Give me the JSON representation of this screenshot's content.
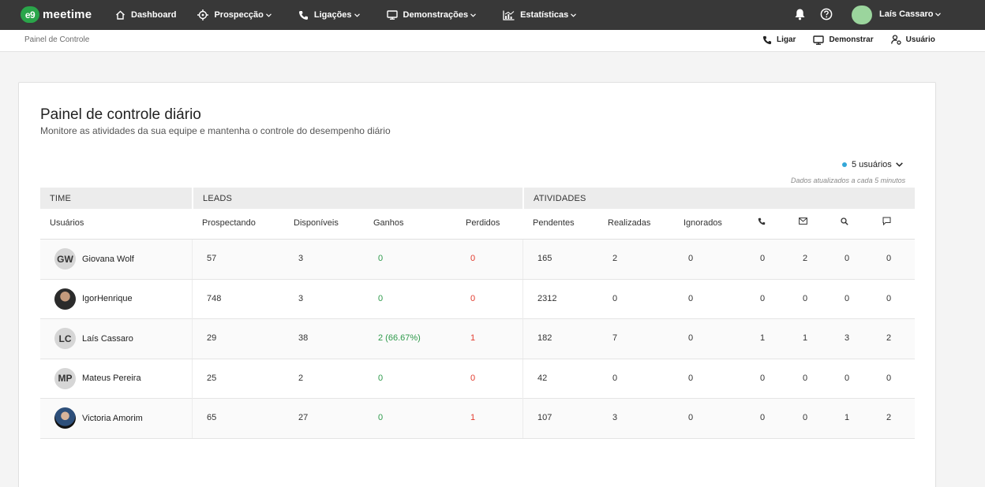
{
  "nav": {
    "logo_mark": "e9",
    "logo_text": "meetime",
    "items": [
      {
        "label": "Dashboard",
        "icon": "home-icon",
        "dropdown": false
      },
      {
        "label": "Prospecção",
        "icon": "target-icon",
        "dropdown": true
      },
      {
        "label": "Ligações",
        "icon": "phone-icon",
        "dropdown": true
      },
      {
        "label": "Demonstrações",
        "icon": "monitor-icon",
        "dropdown": true
      },
      {
        "label": "Estatísticas",
        "icon": "chart-icon",
        "dropdown": true
      }
    ],
    "user_name": "Laís Cassaro"
  },
  "subbar": {
    "breadcrumb": "Painel de Controle",
    "actions": [
      {
        "label": "Ligar",
        "icon": "phone-icon"
      },
      {
        "label": "Demonstrar",
        "icon": "monitor-icon"
      },
      {
        "label": "Usuário",
        "icon": "user-settings-icon"
      }
    ]
  },
  "panel": {
    "title": "Painel de controle diário",
    "subtitle": "Monitore as atividades da sua equipe e mantenha o controle do desempenho diário",
    "users_filter": "5 usuários",
    "update_note": "Dados atualizados a cada 5 minutos"
  },
  "table": {
    "groups": [
      "TIME",
      "LEADS",
      "ATIVIDADES"
    ],
    "headers": [
      "Usuários",
      "Prospectando",
      "Disponíveis",
      "Ganhos",
      "Perdidos",
      "Pendentes",
      "Realizadas",
      "Ignorados"
    ],
    "icon_headers": [
      "phone-icon",
      "mail-icon",
      "search-icon",
      "comment-icon"
    ],
    "rows": [
      {
        "initials": "GW",
        "name": "Giovana Wolf",
        "photo": false,
        "prospectando": "57",
        "disponiveis": "3",
        "ganhos": "0",
        "perdidos": "0",
        "pendentes": "165",
        "realizadas": "2",
        "ignorados": "0",
        "calls": "0",
        "emails": "2",
        "searches": "0",
        "comments": "0"
      },
      {
        "initials": "",
        "name": "IgorHenrique",
        "photo": true,
        "prospectando": "748",
        "disponiveis": "3",
        "ganhos": "0",
        "perdidos": "0",
        "pendentes": "2312",
        "realizadas": "0",
        "ignorados": "0",
        "calls": "0",
        "emails": "0",
        "searches": "0",
        "comments": "0"
      },
      {
        "initials": "LC",
        "name": "Laís Cassaro",
        "photo": false,
        "prospectando": "29",
        "disponiveis": "38",
        "ganhos": "2 (66.67%)",
        "perdidos": "1",
        "pendentes": "182",
        "realizadas": "7",
        "ignorados": "0",
        "calls": "1",
        "emails": "1",
        "searches": "3",
        "comments": "2"
      },
      {
        "initials": "MP",
        "name": "Mateus Pereira",
        "photo": false,
        "prospectando": "25",
        "disponiveis": "2",
        "ganhos": "0",
        "perdidos": "0",
        "pendentes": "42",
        "realizadas": "0",
        "ignorados": "0",
        "calls": "0",
        "emails": "0",
        "searches": "0",
        "comments": "0"
      },
      {
        "initials": "",
        "name": "Victoria Amorim",
        "photo": true,
        "prospectando": "65",
        "disponiveis": "27",
        "ganhos": "0",
        "perdidos": "1",
        "pendentes": "107",
        "realizadas": "3",
        "ignorados": "0",
        "calls": "0",
        "emails": "0",
        "searches": "1",
        "comments": "2"
      }
    ]
  },
  "colors": {
    "navbar": "#383838",
    "brand": "#2aa54a",
    "won": "#2e9a4b",
    "lost": "#e23b2e",
    "filter_dot": "#33a7d8"
  }
}
